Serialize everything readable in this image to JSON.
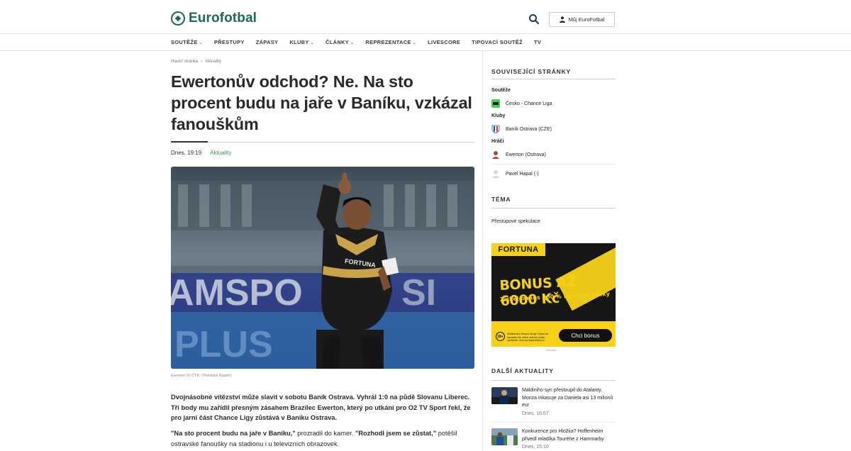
{
  "header": {
    "logo_text": "Eurofotbal",
    "account_label": "Můj EuroFotbal"
  },
  "nav": {
    "items": [
      {
        "label": "SOUTĚŽE",
        "dropdown": true
      },
      {
        "label": "PŘESTUPY",
        "dropdown": false
      },
      {
        "label": "ZÁPASY",
        "dropdown": false
      },
      {
        "label": "KLUBY",
        "dropdown": true
      },
      {
        "label": "ČLÁNKY",
        "dropdown": true
      },
      {
        "label": "REPREZENTACE",
        "dropdown": true
      },
      {
        "label": "LIVESCORE",
        "dropdown": false
      },
      {
        "label": "TIPOVACÍ SOUTĚŽ",
        "dropdown": false
      },
      {
        "label": "TV",
        "dropdown": false
      }
    ]
  },
  "breadcrumb": {
    "home": "Hlavní stránka",
    "separator": "›",
    "current": "Aktuality"
  },
  "article": {
    "title": "Ewertonův odchod? Ne. Na sto procent budu na jaře v Baníku, vzkázal fanouškům",
    "date": "Dnes, 19:19",
    "category": "Aktuality",
    "image_caption": "Ewerton (© ČTK / Petrášek Radek)",
    "lead": "Dvojnásobné vítězství může slavit v sobotu Baník Ostrava. Vyhrál 1:0 na půdě Slovanu Liberec. Tři body mu zařídil přesným zásahem Brazilec Ewerton, který po utkání pro O2 TV Sport řekl, že pro jarní část Chance Ligy zůstává v Baníku Ostrava.",
    "para_quote1": "\"Na sto procent budu na jaře v Baníku,\"",
    "para_text1": " prozradil do kamer. ",
    "para_quote2": "\"Rozhodl jsem se zůstat,\"",
    "para_text2": " potěšil ostravské fanoušky na stadionu i u televizních obrazovek."
  },
  "sidebar": {
    "related_title": "SOUVISEJÍCÍ STRÁNKY",
    "competitions_label": "Soutěže",
    "competition": "Česko - Chance Liga",
    "clubs_label": "Kluby",
    "club": "Baník Ostrava (CZE)",
    "players_label": "Hráči",
    "player1": "Ewerton (Ostrava)",
    "player2": "Pavel Hapal (-)",
    "topic_title": "TÉMA",
    "topic": "Přestupové spekulace",
    "more_news_title": "DALŠÍ AKTUALITY",
    "news": [
      {
        "title": "Maldiniho syn přestoupil do Atalanty, Monza inkasuje za Daniela asi 13 milionů eur",
        "time": "Dnes, 16:57"
      },
      {
        "title": "Konkurence pro Hložka? Hoffenheim přivedl mladíka Touréhe z Hammarby",
        "time": "Dnes, 15:10"
      }
    ]
  },
  "ad": {
    "brand": "FORTUNA",
    "headline": "BONUS AŽ 6000 Kč",
    "sub": "Získej bonus 200 % na první sázky",
    "age": "18+",
    "small_print": "Ministerstvo financí varuje: Účast na hazardní hře může vést ke vzniku závislosti. Více na hazardnihry.cz",
    "cta": "Chci bonus",
    "label": "reklama"
  },
  "colors": {
    "brand_green": "#1c6b52",
    "category_green": "#3a9a52",
    "ad_yellow": "#f7d117"
  }
}
